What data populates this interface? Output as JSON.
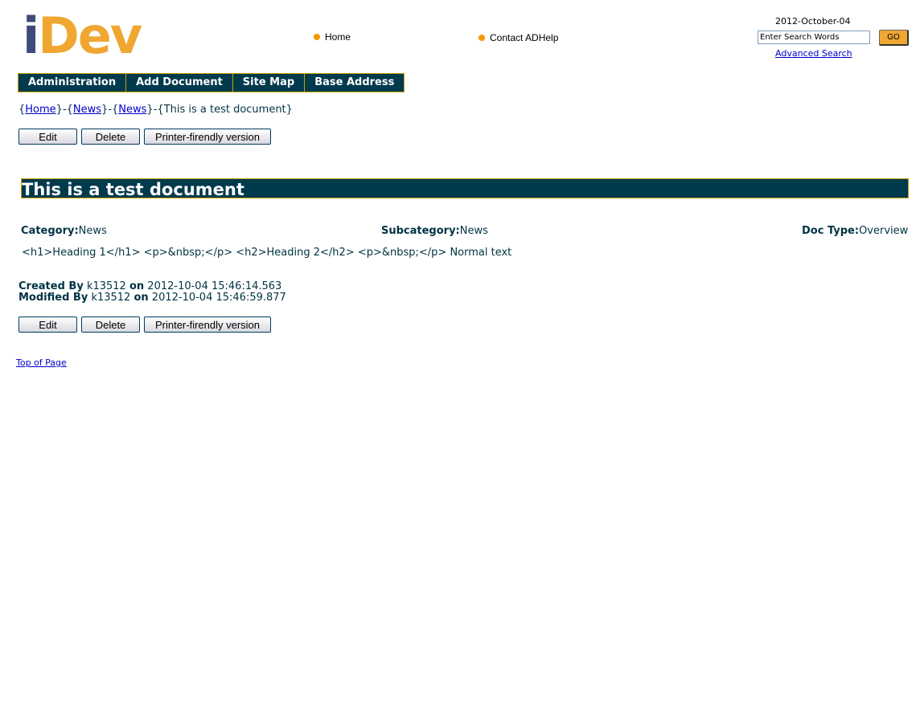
{
  "logo": {
    "part1": "i",
    "part2": "Dev"
  },
  "header": {
    "links": [
      {
        "label": "Home"
      },
      {
        "label": "Contact ADHelp"
      }
    ],
    "date": "2012-October-04",
    "search": {
      "placeholder": "Enter Search Words",
      "value": "Enter Search Words",
      "go_label": "GO",
      "advanced_label": "Advanced Search"
    }
  },
  "nav": {
    "items": [
      {
        "label": "Administration"
      },
      {
        "label": "Add Document"
      },
      {
        "label": "Site Map"
      },
      {
        "label": "Base Address"
      }
    ]
  },
  "breadcrumb": {
    "items": [
      {
        "label": "Home",
        "link": true
      },
      {
        "label": "News",
        "link": true
      },
      {
        "label": "News",
        "link": true
      },
      {
        "label": "This is a test document",
        "link": false
      }
    ]
  },
  "actions": {
    "edit": "Edit",
    "delete": "Delete",
    "print": "Printer-firendly version"
  },
  "document": {
    "title": "This is a test document",
    "category_label": "Category:",
    "category": "News",
    "subcategory_label": "Subcategory:",
    "subcategory": "News",
    "doctype_label": "Doc Type:",
    "doctype": "Overview",
    "body": "<h1>Heading 1</h1> <p>&nbsp;</p> <h2>Heading 2</h2> <p>&nbsp;</p> Normal text"
  },
  "audit": {
    "created_label": "Created By",
    "created_by": "k13512",
    "on_label": "on",
    "created_at": "2012-10-04 15:46:14.563",
    "modified_label": "Modified By",
    "modified_by": "k13512",
    "modified_at": "2012-10-04 15:46:59.877"
  },
  "footer": {
    "top_of_page": "Top of Page"
  },
  "colors": {
    "navy": "#003a4d",
    "gold": "#c8a000",
    "orange": "#f0a732",
    "link": "#0000cc"
  }
}
